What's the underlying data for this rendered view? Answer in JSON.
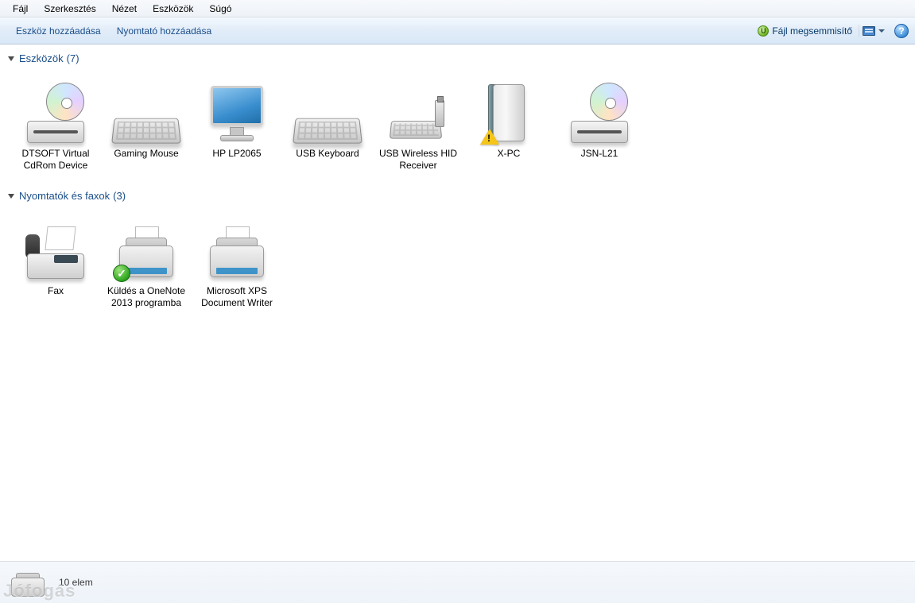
{
  "menu": {
    "file": "Fájl",
    "edit": "Szerkesztés",
    "view": "Nézet",
    "tools": "Eszközök",
    "help": "Súgó"
  },
  "toolbar": {
    "add_device": "Eszköz hozzáadása",
    "add_printer": "Nyomtató hozzáadása",
    "file_shredder": "Fájl megsemmisítő"
  },
  "groups": {
    "devices": {
      "title": "Eszközök",
      "count": "(7)",
      "items": [
        {
          "label": "DTSOFT Virtual CdRom Device"
        },
        {
          "label": "Gaming Mouse"
        },
        {
          "label": "HP LP2065"
        },
        {
          "label": "USB Keyboard"
        },
        {
          "label": "USB Wireless HID Receiver"
        },
        {
          "label": "X-PC"
        },
        {
          "label": "JSN-L21"
        }
      ]
    },
    "printers": {
      "title": "Nyomtatók és faxok",
      "count": "(3)",
      "items": [
        {
          "label": "Fax"
        },
        {
          "label": "Küldés a OneNote 2013 programba"
        },
        {
          "label": "Microsoft XPS Document Writer"
        }
      ]
    }
  },
  "statusbar": {
    "item_count": "10 elem"
  },
  "watermark": "Jófogás"
}
